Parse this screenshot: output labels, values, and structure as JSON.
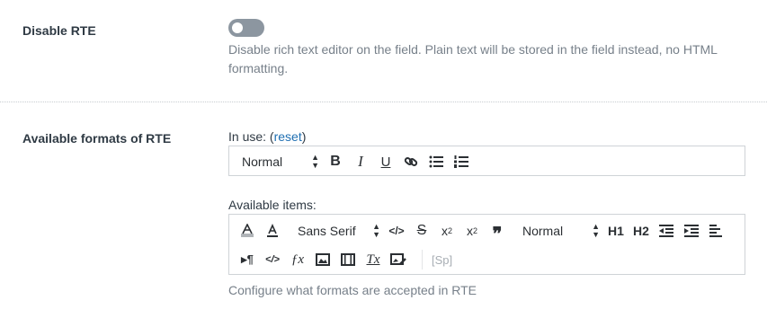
{
  "disable_rte": {
    "label": "Disable RTE",
    "toggle_on": false,
    "help": "Disable rich text editor on the field. Plain text will be stored in the field instead, no HTML formatting."
  },
  "formats": {
    "label": "Available formats of RTE",
    "in_use_prefix": "In use: (",
    "reset_link": "reset",
    "in_use_suffix": ")",
    "in_use": {
      "header_select": "Normal",
      "icons": [
        "bold-icon",
        "italic-icon",
        "underline-icon",
        "link-icon",
        "bullet-list-icon",
        "ordered-list-icon"
      ]
    },
    "available_label": "Available items:",
    "available": {
      "font_select": "Sans Serif",
      "header_select": "Normal",
      "h1": "H1",
      "h2": "H2",
      "sp_placeholder": "[Sp]"
    },
    "help": "Configure what formats are accepted in RTE"
  }
}
